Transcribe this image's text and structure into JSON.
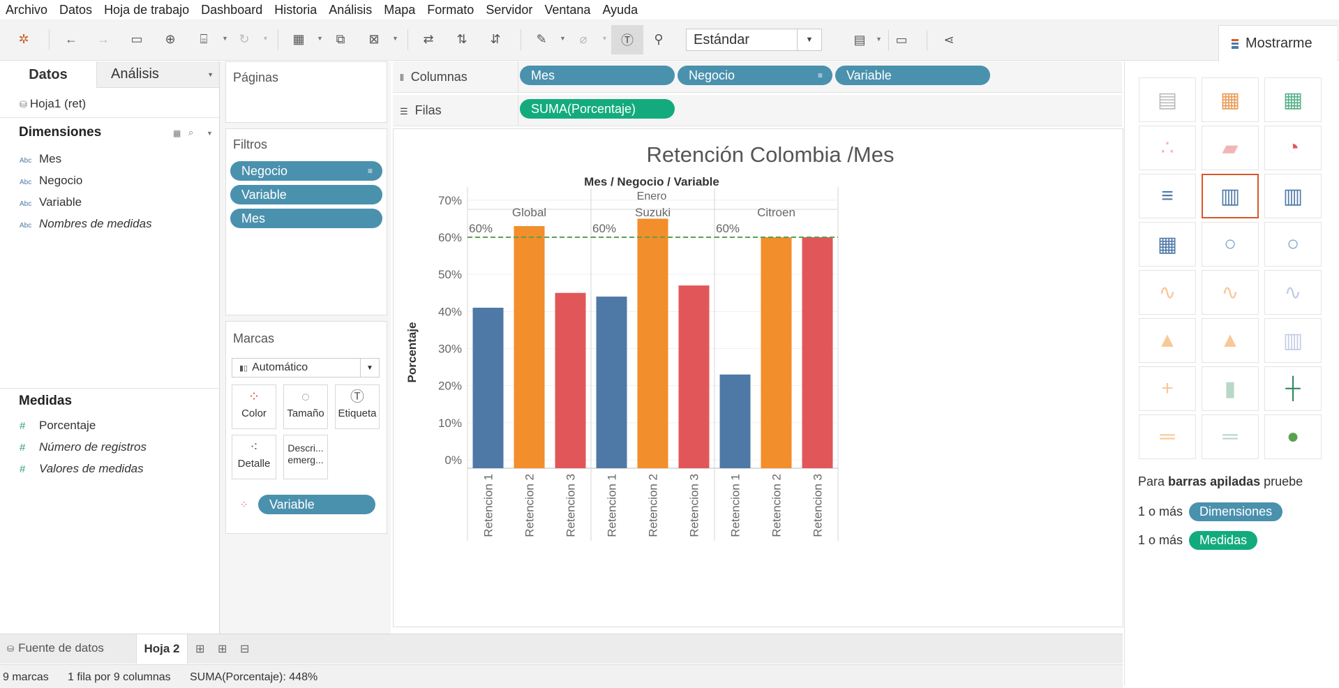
{
  "menu": [
    "Archivo",
    "Datos",
    "Hoja de trabajo",
    "Dashboard",
    "Historia",
    "Análisis",
    "Mapa",
    "Formato",
    "Servidor",
    "Ventana",
    "Ayuda"
  ],
  "toolbar": {
    "fit": "Estándar",
    "show_me": "Mostrarme"
  },
  "data_pane": {
    "tab_data": "Datos",
    "tab_analysis": "Análisis",
    "datasource": "Hoja1 (ret)",
    "dimensions_title": "Dimensiones",
    "dimensions": [
      "Mes",
      "Negocio",
      "Variable",
      "Nombres de medidas"
    ],
    "measures_title": "Medidas",
    "measures": [
      "Porcentaje",
      "Número de registros",
      "Valores de medidas"
    ]
  },
  "cards": {
    "pages_title": "Páginas",
    "filters_title": "Filtros",
    "filters": [
      "Negocio",
      "Variable",
      "Mes"
    ],
    "marks_title": "Marcas",
    "mark_type": "Automático",
    "mark_buttons": [
      "Color",
      "Tamaño",
      "Etiqueta",
      "Detalle",
      "Descri... emerg..."
    ],
    "color_pill": "Variable"
  },
  "shelves": {
    "columns_label": "Columnas",
    "columns": [
      "Mes",
      "Negocio",
      "Variable"
    ],
    "rows_label": "Filas",
    "rows": [
      "SUMA(Porcentaje)"
    ]
  },
  "chart_data": {
    "type": "bar",
    "title": "Retención Colombia /Mes",
    "header": "Mes / Negocio / Variable",
    "month": "Enero",
    "panels": [
      {
        "name": "Global",
        "categories": [
          "Retencion 1",
          "Retencion 2",
          "Retencion 3"
        ],
        "values": [
          0.41,
          0.63,
          0.45
        ]
      },
      {
        "name": "Suzuki",
        "categories": [
          "Retencion 1",
          "Retencion 2",
          "Retencion 3"
        ],
        "values": [
          0.44,
          0.65,
          0.47
        ]
      },
      {
        "name": "Citroen",
        "categories": [
          "Retencion 1",
          "Retencion 2",
          "Retencion 3"
        ],
        "values": [
          0.23,
          0.6,
          0.6
        ]
      }
    ],
    "colors": {
      "Retencion 1": "#4e79a7",
      "Retencion 2": "#f28e2b",
      "Retencion 3": "#e15759"
    },
    "ylabel": "Porcentaje",
    "ylim": [
      0,
      0.75
    ],
    "yticks": [
      "0%",
      "10%",
      "20%",
      "30%",
      "40%",
      "50%",
      "60%",
      "70%"
    ],
    "yticks_values": [
      0,
      0.1,
      0.2,
      0.3,
      0.4,
      0.5,
      0.6,
      0.7
    ],
    "reference_line": {
      "value": 0.6,
      "label": "60%",
      "color": "#59a14f"
    }
  },
  "show_me": {
    "hint_prefix": "Para",
    "hint_bold": "barras apiladas",
    "hint_suffix": "pruebe",
    "req1_prefix": "1 o más",
    "req1_pill": "Dimensiones",
    "req2_prefix": "1 o más",
    "req2_pill": "Medidas"
  },
  "sheet_tabs": {
    "datasource": "Fuente de datos",
    "sheet": "Hoja 2"
  },
  "status": {
    "marks": "9 marcas",
    "layout": "1 fila por 9 columnas",
    "sum": "SUMA(Porcentaje): 448%"
  }
}
